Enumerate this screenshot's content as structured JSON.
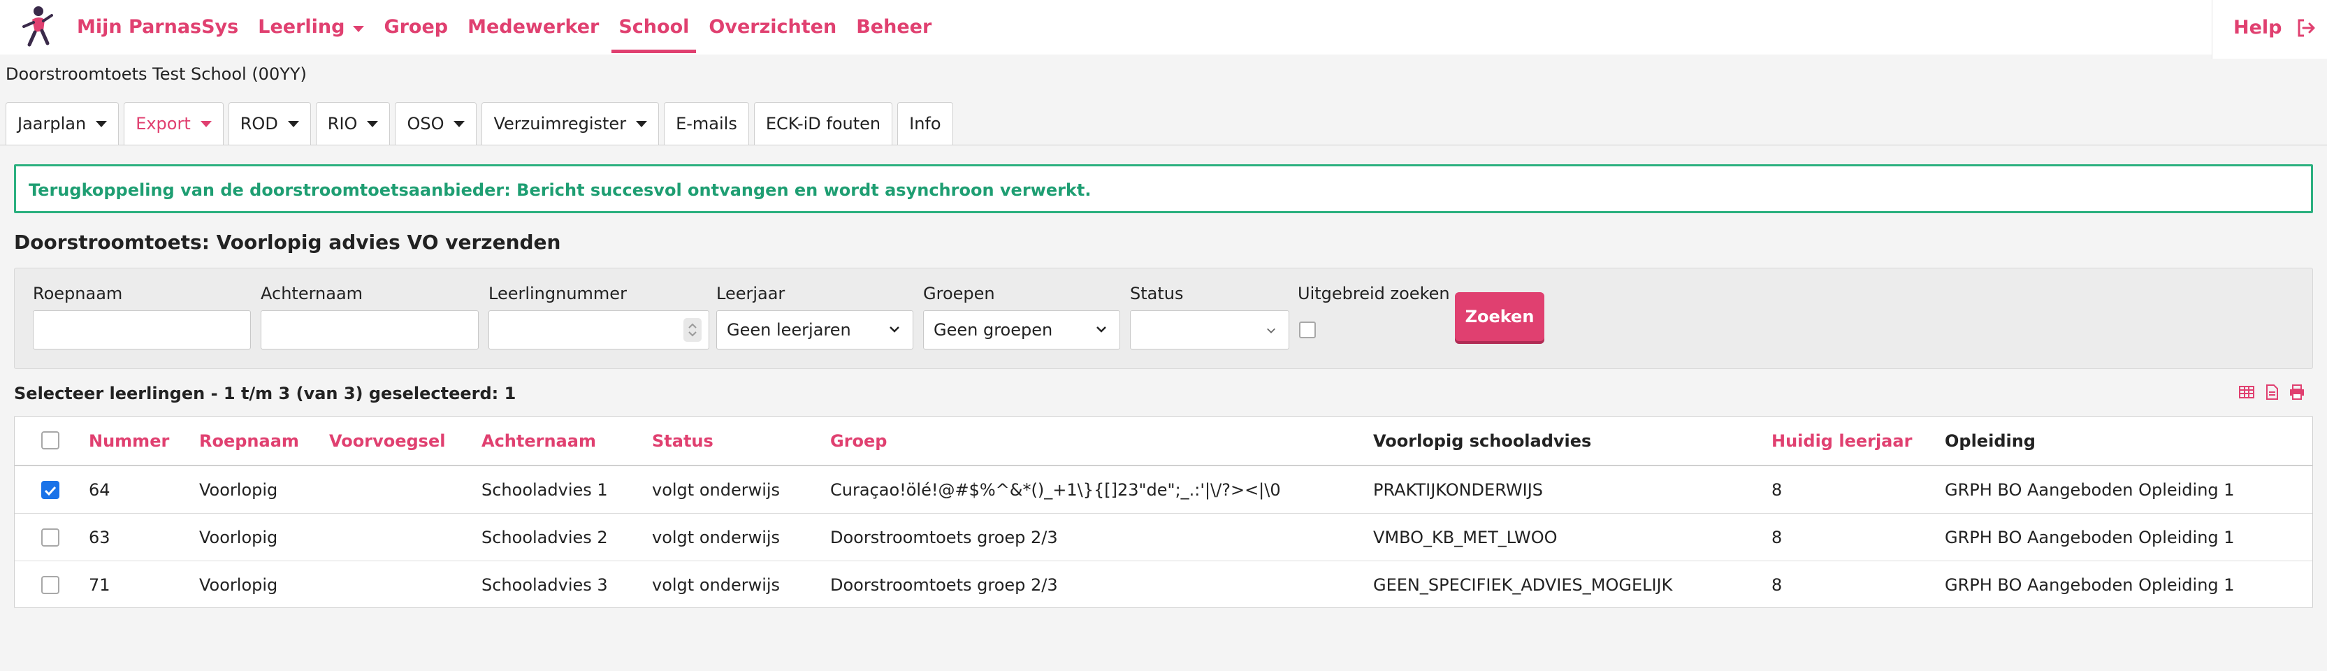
{
  "nav": {
    "items": [
      {
        "label": "Mijn ParnasSys",
        "active": false,
        "dropdown": false
      },
      {
        "label": "Leerling",
        "active": false,
        "dropdown": true
      },
      {
        "label": "Groep",
        "active": false,
        "dropdown": false
      },
      {
        "label": "Medewerker",
        "active": false,
        "dropdown": false
      },
      {
        "label": "School",
        "active": true,
        "dropdown": false
      },
      {
        "label": "Overzichten",
        "active": false,
        "dropdown": false
      },
      {
        "label": "Beheer",
        "active": false,
        "dropdown": false
      }
    ],
    "help_label": "Help",
    "logo_icon": "parnassys-logo-icon",
    "logout_icon": "logout-icon"
  },
  "school_name": "Doorstroomtoets Test School (00YY)",
  "tabs": [
    {
      "label": "Jaarplan",
      "dropdown": true,
      "highlight": false
    },
    {
      "label": "Export",
      "dropdown": true,
      "highlight": true
    },
    {
      "label": "ROD",
      "dropdown": true,
      "highlight": false
    },
    {
      "label": "RIO",
      "dropdown": true,
      "highlight": false
    },
    {
      "label": "OSO",
      "dropdown": true,
      "highlight": false
    },
    {
      "label": "Verzuimregister",
      "dropdown": true,
      "highlight": false
    },
    {
      "label": "E-mails",
      "dropdown": false,
      "highlight": false
    },
    {
      "label": "ECK-iD fouten",
      "dropdown": false,
      "highlight": false
    },
    {
      "label": "Info",
      "dropdown": false,
      "highlight": false
    }
  ],
  "alert": {
    "text": "Terugkoppeling van de doorstroomtoetsaanbieder: Bericht succesvol ontvangen en wordt asynchroon verwerkt."
  },
  "page_title": "Doorstroomtoets: Voorlopig advies VO verzenden",
  "filters": {
    "roepnaam": {
      "label": "Roepnaam",
      "value": ""
    },
    "achternaam": {
      "label": "Achternaam",
      "value": ""
    },
    "leerlingnummer": {
      "label": "Leerlingnummer",
      "value": ""
    },
    "leerjaar": {
      "label": "Leerjaar",
      "value": "Geen leerjaren"
    },
    "groepen": {
      "label": "Groepen",
      "value": "Geen groepen"
    },
    "status": {
      "label": "Status",
      "value": ""
    },
    "uitgebreid": {
      "label": "Uitgebreid zoeken",
      "checked": false
    },
    "search_button": "Zoeken"
  },
  "selection_summary": "Selecteer leerlingen - 1 t/m 3 (van 3) geselecteerd: 1",
  "table": {
    "columns": [
      "Nummer",
      "Roepnaam",
      "Voorvoegsel",
      "Achternaam",
      "Status",
      "Groep",
      "Voorlopig schooladvies",
      "Huidig leerjaar",
      "Opleiding"
    ],
    "rows": [
      {
        "checked": true,
        "cells": [
          "64",
          "Voorlopig",
          "",
          "Schooladvies 1",
          "volgt onderwijs",
          "Curaçao!ölé!@#$%^&*()_+1\\}{[]23\"de\";_.:'|\\/?><|\\0",
          "PRAKTIJKONDERWIJS",
          "8",
          "GRPH BO Aangeboden Opleiding 1"
        ]
      },
      {
        "checked": false,
        "cells": [
          "63",
          "Voorlopig",
          "",
          "Schooladvies 2",
          "volgt onderwijs",
          "Doorstroomtoets groep 2/3",
          "VMBO_KB_MET_LWOO",
          "8",
          "GRPH BO Aangeboden Opleiding 1"
        ]
      },
      {
        "checked": false,
        "cells": [
          "71",
          "Voorlopig",
          "",
          "Schooladvies 3",
          "volgt onderwijs",
          "Doorstroomtoets groep 2/3",
          "GEEN_SPECIFIEK_ADVIES_MOGELIJK",
          "8",
          "GRPH BO Aangeboden Opleiding 1"
        ]
      }
    ]
  },
  "colors": {
    "accent": "#e04070",
    "success": "#2bb07f",
    "checkbox": "#1a73e8"
  }
}
